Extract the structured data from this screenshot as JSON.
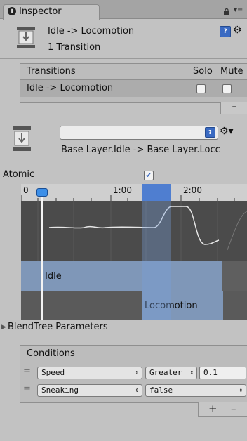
{
  "tab": {
    "label": "Inspector",
    "info_glyph": "i",
    "menu_glyph": "▾≡"
  },
  "header": {
    "title": "Idle -> Locomotion",
    "subtitle": "1 Transition",
    "help_glyph": "?",
    "gear_glyph": "⚙"
  },
  "transitions": {
    "header": {
      "label": "Transitions",
      "solo": "Solo",
      "mute": "Mute"
    },
    "rows": [
      {
        "label": "Idle -> Locomotion",
        "solo": false,
        "mute": false
      }
    ],
    "remove_label": "–"
  },
  "layer": {
    "path": "Base Layer.Idle -> Base Layer.Locc",
    "help_glyph": "?",
    "gear_glyph": "⚙▾"
  },
  "atomic": {
    "label": "Atomic",
    "checked": true,
    "check_glyph": "✔"
  },
  "timeline": {
    "ruler_labels": [
      "0",
      "1:00",
      "2:00"
    ],
    "tracks": [
      "Idle",
      "Locomotion"
    ]
  },
  "blendtree": {
    "label": "BlendTree Parameters",
    "arrow_glyph": "▶"
  },
  "conditions": {
    "title": "Conditions",
    "rows": [
      {
        "param": "Speed",
        "operator": "Greater",
        "value": "0.1"
      },
      {
        "param": "Sneaking",
        "operator": "false"
      }
    ],
    "add_label": "+",
    "remove_label": "–"
  },
  "icons": {
    "handle_glyph": "=",
    "dropdown_glyph": "⇕"
  },
  "colors": {
    "accent": "#4f7ed0",
    "track_bar": "#7f97b8",
    "curve_bg": "#4b4b4b",
    "panel_bg": "#c2c2c2"
  }
}
